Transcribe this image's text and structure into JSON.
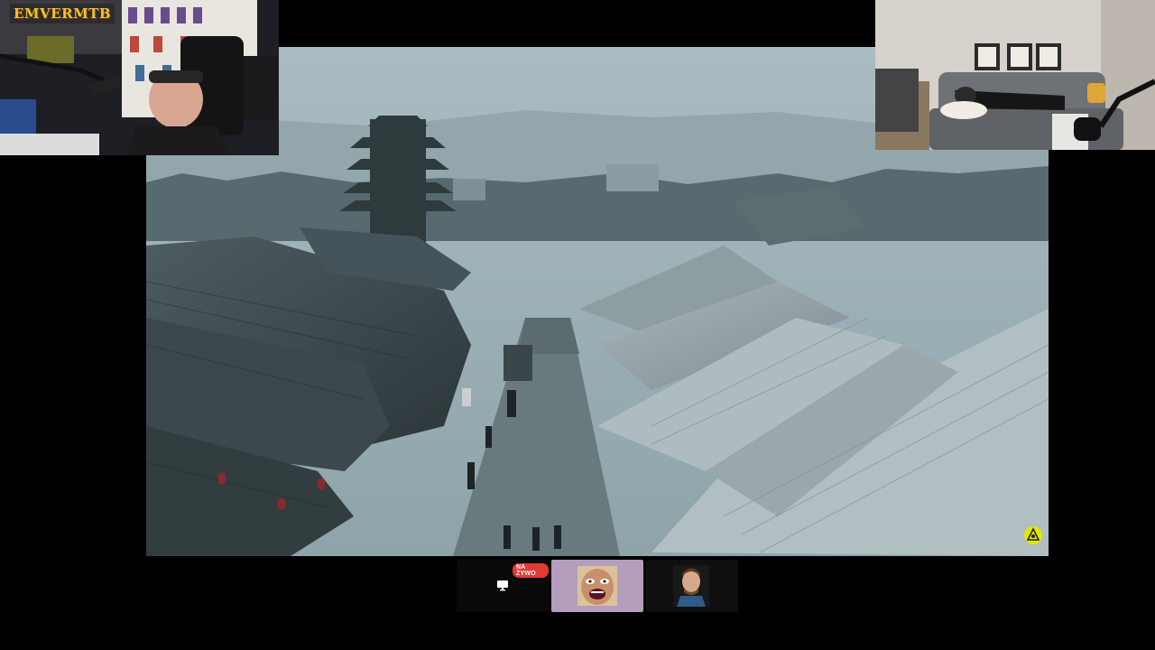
{
  "overlay": {
    "logo_text": "EMVERMTB"
  },
  "participants": [
    {
      "id": "screen-share",
      "live_label": "NA ŻYWO",
      "icon": "monitor-icon"
    },
    {
      "id": "meme-face",
      "icon": "avatar-face"
    },
    {
      "id": "person",
      "icon": "avatar-person"
    }
  ],
  "colors": {
    "live": "#e53935",
    "tile_highlight": "#b49dbd",
    "logo": "#f2c12e",
    "watermark": "#e6e600"
  }
}
